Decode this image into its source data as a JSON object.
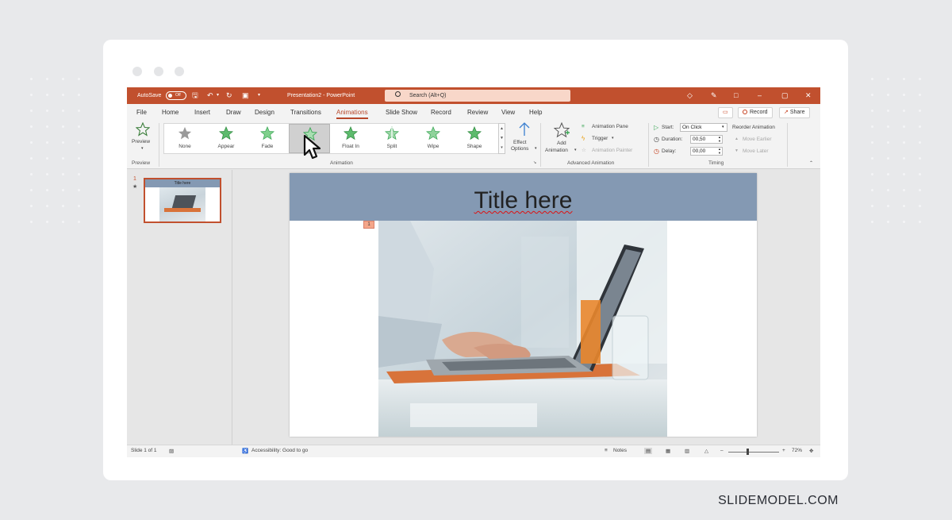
{
  "app": {
    "autosave_label": "AutoSave",
    "autosave_state": "Off",
    "document_title": "Presentation2 - PowerPoint",
    "search_placeholder": "Search (Alt+Q)"
  },
  "tabs": [
    "File",
    "Home",
    "Insert",
    "Draw",
    "Design",
    "Transitions",
    "Animations",
    "Slide Show",
    "Record",
    "Review",
    "View",
    "Help"
  ],
  "active_tab": "Animations",
  "header_buttons": {
    "record": "Record",
    "share": "Share"
  },
  "ribbon": {
    "preview_label": "Preview",
    "preview_group": "Preview",
    "animations": [
      "None",
      "Appear",
      "Fade",
      "",
      "Float In",
      "Split",
      "Wipe",
      "Shape"
    ],
    "effect_options_1": "Effect",
    "effect_options_2": "Options",
    "animation_group": "Animation",
    "add_animation_1": "Add",
    "add_animation_2": "Animation",
    "animation_pane": "Animation Pane",
    "trigger": "Trigger",
    "animation_painter": "Animation Painter",
    "advanced_group": "Advanced Animation",
    "start_label": "Start:",
    "start_value": "On Click",
    "duration_label": "Duration:",
    "duration_value": "00,50",
    "delay_label": "Delay:",
    "delay_value": "00,00",
    "timing_group": "Timing",
    "reorder_title": "Reorder Animation",
    "move_earlier": "Move Earlier",
    "move_later": "Move Later"
  },
  "slides_panel": {
    "slide_number": "1",
    "thumbnail_title": "Title here"
  },
  "slide": {
    "title": "Title here",
    "animation_tag": "1"
  },
  "status": {
    "slide_info": "Slide 1 of 1",
    "accessibility": "Accessibility: Good to go",
    "notes": "Notes",
    "zoom": "72%"
  },
  "watermark": "SLIDEMODEL.COM",
  "colors": {
    "accent": "#c1502e",
    "title_bar": "#8499b3",
    "star_green": "#3aa655"
  }
}
